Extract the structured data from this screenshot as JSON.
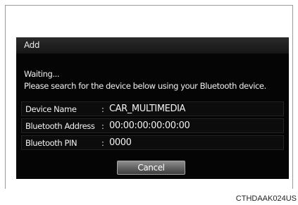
{
  "dialog": {
    "title": "Add",
    "message_line1": "Waiting...",
    "message_line2": "Please search for the device below using your Bluetooth device.",
    "rows": [
      {
        "label": "Device Name",
        "colon": ":",
        "value": "CAR_MULTIMEDIA"
      },
      {
        "label": "Bluetooth Address",
        "colon": ":",
        "value": "00:00:00:00:00:00"
      },
      {
        "label": "Bluetooth PIN",
        "colon": ":",
        "value": "0000"
      }
    ],
    "cancel_label": "Cancel"
  },
  "caption": "CTHDAAK024US",
  "colors": {
    "screen_background": "#050505",
    "text": "#f2f2f2",
    "button_gradient_top": "#8e8e8e",
    "button_gradient_bottom": "#3c3c3c"
  }
}
